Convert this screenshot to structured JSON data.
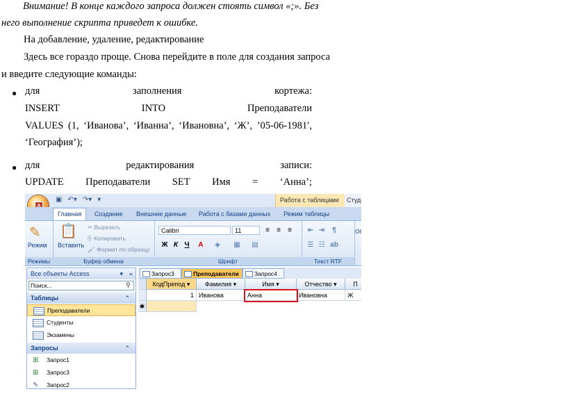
{
  "document": {
    "warning_line1": "Внимание! В конце каждого запроса должен стоять символ «;». Без",
    "warning_line2": "него выполнение скрипта приведет к ошибке.",
    "heading": "На добавление, удаление, редактирование",
    "intro_line1": "Здесь все гораздо проще. Снова перейдите в поле для создания запроса",
    "intro_line2": "и введите следующие команды:",
    "bullet1": {
      "words": [
        "для",
        "заполнения",
        "кортежа:"
      ],
      "code1": [
        "INSERT",
        "INTO",
        "Преподаватели"
      ],
      "code2": [
        "VALUES",
        "(1,",
        "‘Иванова’,",
        "‘Иванна’,",
        "‘Ивановна’,",
        "‘Ж’,",
        "’05-06-1981′,"
      ],
      "code3": "‘География’);"
    },
    "bullet2": {
      "words": [
        "для",
        "редактирования",
        "записи:"
      ],
      "code1": [
        "UPDATE",
        "Преподаватели",
        "SET",
        "Имя",
        "=",
        "‘Анна’;"
      ]
    }
  },
  "access": {
    "contextual_tab": "Работа с таблицами",
    "contextual_tab2": "Студе",
    "ribbon_tabs": [
      "Главная",
      "Создание",
      "Внешние данные",
      "Работа с базами данных",
      "Режим таблицы"
    ],
    "groups": {
      "modes": {
        "label": "Режимы",
        "button": "Режим"
      },
      "clipboard": {
        "label": "Буфер обмена",
        "paste": "Вставить",
        "cut": "Вырезать",
        "copy": "Копировать",
        "format": "Формат по образцу"
      },
      "font": {
        "label": "Шрифт",
        "font_name": "Calibri",
        "font_size": "11"
      },
      "rtf": {
        "label": "Текст RTF"
      },
      "extra": "Об"
    },
    "nav": {
      "header": "Все объекты Access",
      "search_placeholder": "Поиск...",
      "tables_section": "Таблицы",
      "tables": [
        "Преподаватели",
        "Студенты",
        "Экзамены"
      ],
      "queries_section": "Запросы",
      "queries": [
        "Запрос1",
        "Запрос3",
        "Запрос2"
      ]
    },
    "doc_tabs": [
      "Запрос3",
      "Преподаватели",
      "Запрос4"
    ],
    "table": {
      "columns": [
        "КодПрепод",
        "Фамилия",
        "Имя",
        "Отчество",
        "П"
      ],
      "row": [
        "1",
        "Иванова",
        "Анна",
        "Ивановна",
        "Ж"
      ],
      "new_row_marker": "✱"
    }
  }
}
